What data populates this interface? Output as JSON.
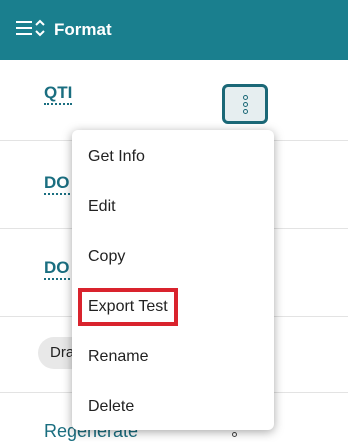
{
  "header": {
    "title": "Format",
    "sort_icon": "sort-icon"
  },
  "rows": [
    {
      "label": "QTI"
    },
    {
      "label": "DO"
    },
    {
      "label": "DO"
    }
  ],
  "chip": {
    "label": "Dra"
  },
  "regenerate": {
    "label": "Regenerate"
  },
  "menu": {
    "items": [
      {
        "label": "Get Info"
      },
      {
        "label": "Edit"
      },
      {
        "label": "Copy"
      },
      {
        "label": "Export Test",
        "highlighted": true
      },
      {
        "label": "Rename"
      },
      {
        "label": "Delete"
      }
    ]
  },
  "colors": {
    "header_bg": "#1a7f8e",
    "link": "#1a6e80",
    "highlight": "#d9232d"
  }
}
